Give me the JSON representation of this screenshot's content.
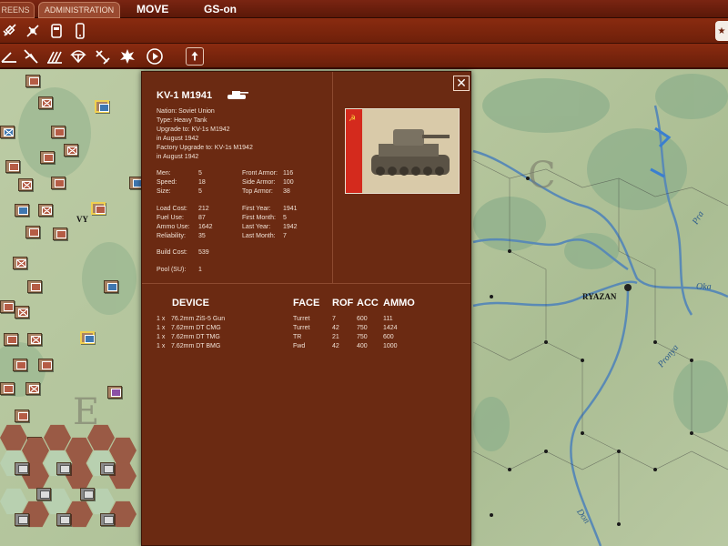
{
  "topbar": {
    "tab_screens": "REENS",
    "tab_admin": "ADMINISTRATION",
    "move_label": "MOVE",
    "gs_label": "GS-on"
  },
  "toolbar": {
    "row1_icons": [
      "satellite-icon",
      "satellite-alt-icon",
      "document-icon",
      "phone-icon"
    ],
    "row2_icons": [
      "artillery-icon",
      "recon-plane-icon",
      "rockets-icon",
      "airdrop-icon",
      "air-strike-icon",
      "explosion-icon",
      "play-turn-icon",
      "upload-icon"
    ],
    "star_icon": "star-icon"
  },
  "map": {
    "labels": {
      "ryazan": "RYAZAN",
      "oka": "Oka",
      "pra": "Pra",
      "pronya": "Pronya",
      "don": "Don",
      "city_left": "VY"
    },
    "colors": {
      "terrain": "#b9c9a4",
      "forest": "#8fb08c",
      "river": "#5a8ab5"
    }
  },
  "dialog": {
    "close_label": "✕",
    "unit_name": "KV-1 M1941",
    "info": [
      "Nation: Soviet Union",
      "Type: Heavy Tank",
      "Upgrade to: KV-1s M1942",
      "in August 1942",
      "Factory Upgrade to: KV-1s M1942",
      "in August 1942"
    ],
    "stats_left": [
      {
        "label": "Men:",
        "value": "5"
      },
      {
        "label": "Speed:",
        "value": "18"
      },
      {
        "label": "Size:",
        "value": "5"
      },
      {
        "label": "Load Cost:",
        "value": "212"
      },
      {
        "label": "Fuel Use:",
        "value": "87"
      },
      {
        "label": "Ammo Use:",
        "value": "1642"
      },
      {
        "label": "Reliability:",
        "value": "35"
      },
      {
        "label": "Build Cost:",
        "value": "539"
      },
      {
        "label": "Pool (SU):",
        "value": "1"
      }
    ],
    "stats_right": [
      {
        "label": "Front Armor:",
        "value": "116"
      },
      {
        "label": "Side Armor:",
        "value": "100"
      },
      {
        "label": "Top Armor:",
        "value": "38"
      },
      {
        "label": "First Year:",
        "value": "1941"
      },
      {
        "label": "First Month:",
        "value": "5"
      },
      {
        "label": "Last Year:",
        "value": "1942"
      },
      {
        "label": "Last Month:",
        "value": "7"
      }
    ],
    "devices_header": {
      "device": "DEVICE",
      "face": "FACE",
      "rof": "ROF",
      "acc": "ACC",
      "ammo": "AMMO"
    },
    "devices": [
      {
        "qty": "1 x",
        "name": "76.2mm ZiS-5 Gun",
        "face": "Turret",
        "rof": "7",
        "acc": "600",
        "ammo": "111"
      },
      {
        "qty": "1 x",
        "name": "7.62mm DT CMG",
        "face": "Turret",
        "rof": "42",
        "acc": "750",
        "ammo": "1424"
      },
      {
        "qty": "1 x",
        "name": "7.62mm DT TMG",
        "face": "TR",
        "rof": "21",
        "acc": "750",
        "ammo": "600"
      },
      {
        "qty": "1 x",
        "name": "7.62mm DT BMG",
        "face": "Fwd",
        "rof": "42",
        "acc": "400",
        "ammo": "1000"
      }
    ],
    "colors": {
      "panel": "#6b2a12",
      "flag_red": "#d42a1d"
    }
  }
}
